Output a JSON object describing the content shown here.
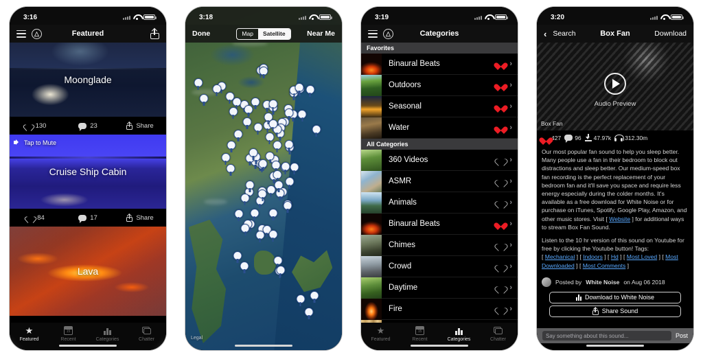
{
  "phone1": {
    "status": {
      "time": "3:16"
    },
    "nav": {
      "title": "Featured",
      "menu_icon": "hamburger-icon",
      "logo_icon": "app-logo-icon",
      "share_icon": "share-icon"
    },
    "cards": [
      {
        "title": "Moonglade",
        "likes": "130",
        "comments": "23",
        "share_label": "Share",
        "mute_label": ""
      },
      {
        "title": "Cruise Ship Cabin",
        "likes": "84",
        "comments": "17",
        "share_label": "Share",
        "mute_label": "Tap to Mute"
      },
      {
        "title": "Lava",
        "likes": "",
        "comments": "",
        "share_label": "",
        "mute_label": ""
      }
    ],
    "tabs": [
      {
        "label": "Featured",
        "icon": "star-icon",
        "active": true
      },
      {
        "label": "Recent",
        "icon": "calendar-icon",
        "active": false
      },
      {
        "label": "Categories",
        "icon": "categories-icon",
        "active": false
      },
      {
        "label": "Chatter",
        "icon": "chat-icon",
        "active": false
      }
    ]
  },
  "phone2": {
    "status": {
      "time": "3:18"
    },
    "nav": {
      "done_label": "Done",
      "near_me_label": "Near Me"
    },
    "segmented": {
      "options": [
        "Map",
        "Satellite"
      ],
      "selected": "Satellite"
    },
    "map": {
      "legal_label": "Legal",
      "pin_icon": "map-pin-icon",
      "pin_count": 78
    }
  },
  "phone3": {
    "status": {
      "time": "3:19"
    },
    "nav": {
      "title": "Categories",
      "menu_icon": "hamburger-icon",
      "logo_icon": "app-logo-icon"
    },
    "sections": [
      {
        "header": "Favorites",
        "items": [
          {
            "label": "Binaural Beats",
            "favorited": true,
            "thumb": "t-binaural"
          },
          {
            "label": "Outdoors",
            "favorited": true,
            "thumb": "t-outdoors"
          },
          {
            "label": "Seasonal",
            "favorited": true,
            "thumb": "t-seasonal"
          },
          {
            "label": "Water",
            "favorited": true,
            "thumb": "t-water"
          }
        ]
      },
      {
        "header": "All Categories",
        "items": [
          {
            "label": "360 Videos",
            "favorited": false,
            "thumb": "t-360"
          },
          {
            "label": "ASMR",
            "favorited": false,
            "thumb": "t-asmr"
          },
          {
            "label": "Animals",
            "favorited": false,
            "thumb": "t-animals"
          },
          {
            "label": "Binaural Beats",
            "favorited": true,
            "thumb": "t-binaural2"
          },
          {
            "label": "Chimes",
            "favorited": false,
            "thumb": "t-chimes"
          },
          {
            "label": "Crowd",
            "favorited": false,
            "thumb": "t-crowd"
          },
          {
            "label": "Daytime",
            "favorited": false,
            "thumb": "t-daytime"
          },
          {
            "label": "Fire",
            "favorited": false,
            "thumb": "t-fire"
          }
        ]
      }
    ],
    "tabs": [
      {
        "label": "Featured",
        "icon": "star-icon",
        "active": false
      },
      {
        "label": "Recent",
        "icon": "calendar-icon",
        "active": false
      },
      {
        "label": "Categories",
        "icon": "categories-icon",
        "active": true
      },
      {
        "label": "Chatter",
        "icon": "chat-icon",
        "active": false
      }
    ]
  },
  "phone4": {
    "status": {
      "time": "3:20"
    },
    "nav": {
      "back_label": "Search",
      "title": "Box Fan",
      "download_label": "Download"
    },
    "hero": {
      "caption": "Box Fan",
      "preview_label": "Audio Preview",
      "play_icon": "play-icon"
    },
    "stats": {
      "likes": "427",
      "comments": "96",
      "downloads": "47.97k",
      "listens": "312.30m"
    },
    "description": {
      "para1_a": "Our most popular fan sound to help you sleep better.  Many people use a fan in their bedroom to block out distractions and sleep better.  Our medium-speed box fan recording is the perfect replacement of your bedroom fan and it'll save you space and require less energy especially during the colder months.  It's available as a free download for White Noise or for purchase on iTunes, Spotify, Google Play, Amazon, and other music stores.  Visit [ ",
      "website_link": "Website",
      "para1_b": " ] for additional ways to stream Box Fan Sound.",
      "para2": "Listen to the 10 hr version of this sound on Youtube for free by clicking the Youtube button!  Tags:",
      "tags": [
        "Mechanical",
        "Indoors",
        "Hd",
        "Most Loved",
        "Most Downloaded",
        "Most Comments"
      ]
    },
    "posted": {
      "prefix": "Posted by",
      "author": "White Noise",
      "suffix": "on Aug 06 2018"
    },
    "buttons": {
      "download_to_white_noise": "Download to White Noise",
      "share_sound": "Share Sound"
    },
    "comment": {
      "placeholder": "Say something about this sound...",
      "post_label": "Post"
    }
  }
}
